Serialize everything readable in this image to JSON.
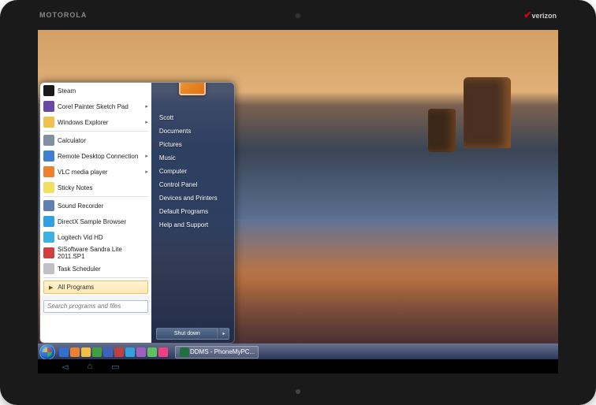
{
  "device": {
    "brand_left": "MOTOROLA",
    "brand_right": "verizon"
  },
  "start_menu": {
    "programs": [
      {
        "label": "Steam",
        "icon_color": "#1a1a1a",
        "has_submenu": false
      },
      {
        "label": "Corel Painter Sketch Pad",
        "icon_color": "#6a4aa0",
        "has_submenu": true
      },
      {
        "label": "Windows Explorer",
        "icon_color": "#f0c050",
        "has_submenu": true
      },
      {
        "label": "Calculator",
        "icon_color": "#8090a0",
        "has_submenu": false
      },
      {
        "label": "Remote Desktop Connection",
        "icon_color": "#4080d0",
        "has_submenu": true
      },
      {
        "label": "VLC media player",
        "icon_color": "#f08030",
        "has_submenu": true
      },
      {
        "label": "Sticky Notes",
        "icon_color": "#f0e060",
        "has_submenu": false
      },
      {
        "label": "Sound Recorder",
        "icon_color": "#6080b0",
        "has_submenu": false
      },
      {
        "label": "DirectX Sample Browser",
        "icon_color": "#30a0e0",
        "has_submenu": false
      },
      {
        "label": "Logitech Vid HD",
        "icon_color": "#40b0e0",
        "has_submenu": false
      },
      {
        "label": "SiSoftware Sandra Lite 2011.SP1",
        "icon_color": "#d04040",
        "has_submenu": false
      },
      {
        "label": "Task Scheduler",
        "icon_color": "#c0c0c8",
        "has_submenu": false
      }
    ],
    "all_programs_label": "All Programs",
    "search_placeholder": "Search programs and files",
    "right_items": [
      "Scott",
      "Documents",
      "Pictures",
      "Music",
      "Computer",
      "Control Panel",
      "Devices and Printers",
      "Default Programs",
      "Help and Support"
    ],
    "shutdown_label": "Shut down"
  },
  "taskbar": {
    "task_label": "DDMS - PhoneMyPC...",
    "pinned_colors": [
      "#3070d0",
      "#f08030",
      "#f0c040",
      "#40a040",
      "#4060c0",
      "#c04040",
      "#30a0e0",
      "#a060c0",
      "#60c060",
      "#f04080"
    ]
  }
}
